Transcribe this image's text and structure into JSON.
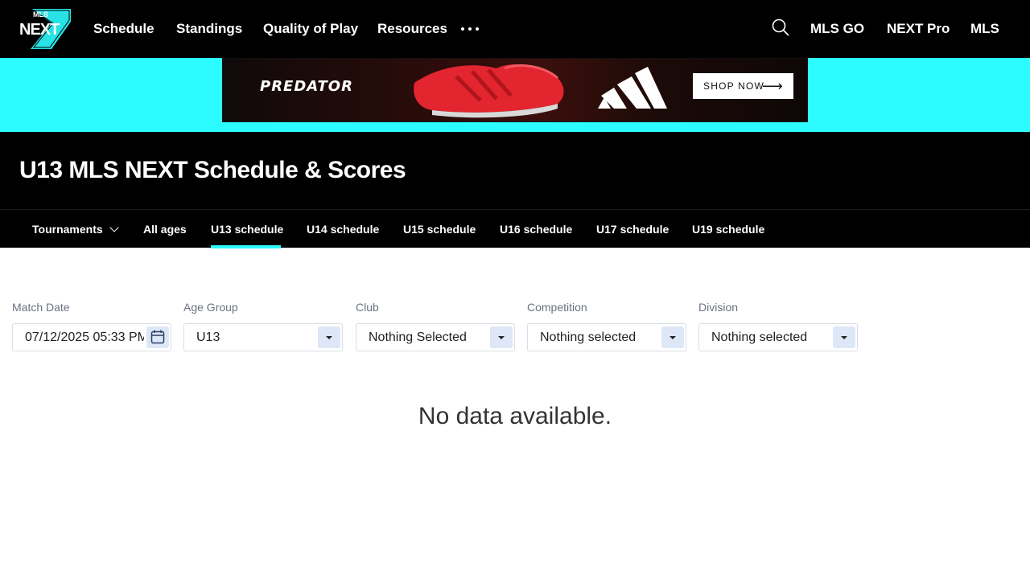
{
  "topnav": {
    "logo_text_top": "MLS",
    "logo_text_main": "NEXT",
    "links": [
      "Schedule",
      "Standings",
      "Quality of Play",
      "Resources"
    ],
    "more_icon": "more-horizontal-icon",
    "search_icon": "search-icon",
    "right_links": [
      "MLS GO",
      "NEXT Pro",
      "MLS"
    ]
  },
  "ad": {
    "brand": "PREDATOR",
    "cta": "SHOP NOW",
    "cta_arrow": "⟶",
    "background_color": "#2cfcff"
  },
  "page": {
    "title": "U13 MLS NEXT Schedule & Scores"
  },
  "subnav": {
    "tournaments": "Tournaments",
    "items": [
      "All ages",
      "U13 schedule",
      "U14 schedule",
      "U15 schedule",
      "U16 schedule",
      "U17 schedule",
      "U19 schedule"
    ],
    "active": "U13 schedule",
    "accent_color": "#2cfcff"
  },
  "filters": {
    "match_date": {
      "label": "Match Date",
      "value": "07/12/2025 05:33 PM",
      "icon": "calendar-icon"
    },
    "age_group": {
      "label": "Age Group",
      "value": "U13"
    },
    "club": {
      "label": "Club",
      "value": "Nothing Selected"
    },
    "competition": {
      "label": "Competition",
      "value": "Nothing selected"
    },
    "division": {
      "label": "Division",
      "value": "Nothing selected"
    }
  },
  "results": {
    "empty_message": "No data available."
  }
}
